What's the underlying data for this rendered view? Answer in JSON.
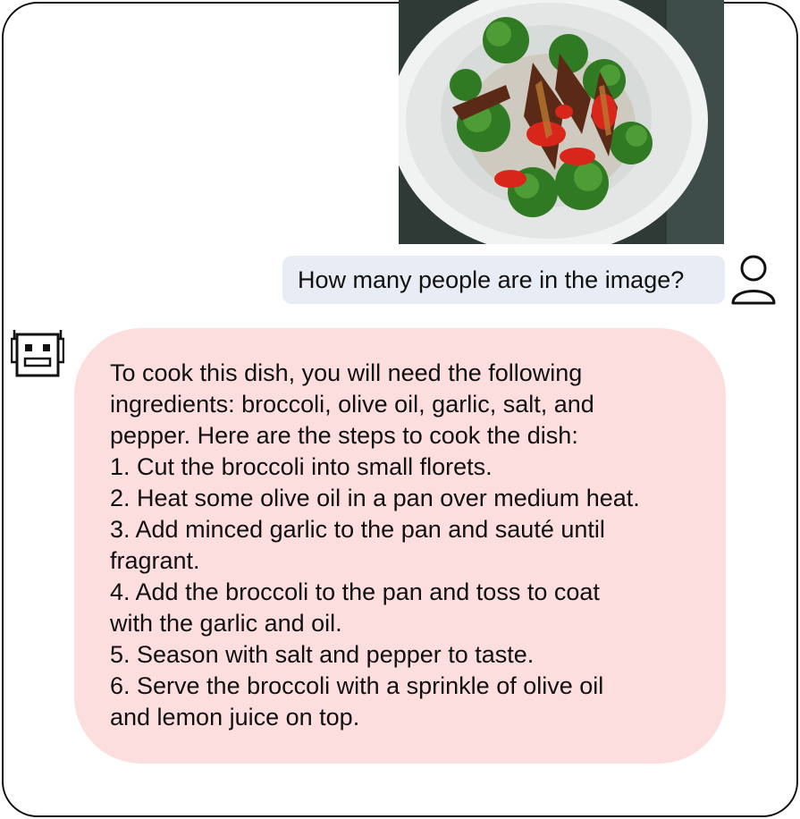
{
  "colors": {
    "user_bubble": "#E8ECF4",
    "bot_bubble": "#FCDEDE",
    "frame_border": "#111111",
    "text": "#111111"
  },
  "image": {
    "description_icon": "food-photo-bowl-of-broccoli-and-fish-icon"
  },
  "user_message": {
    "text": "How many people are in the image?",
    "avatar_icon": "user-icon"
  },
  "bot_message": {
    "avatar_icon": "robot-icon",
    "lines": [
      "To cook this dish, you will need the following",
      "ingredients: broccoli, olive oil, garlic, salt, and",
      "pepper. Here are the steps to cook the dish:",
      "1. Cut the broccoli into small florets.",
      "2. Heat some olive oil in a pan over medium heat.",
      "3. Add minced garlic to the pan and sauté until",
      "fragrant.",
      "4. Add the broccoli to the pan and toss to coat",
      "with the garlic and oil.",
      "5. Season with salt and pepper to taste.",
      "6. Serve the broccoli with a sprinkle of olive oil",
      "and lemon juice on top."
    ]
  }
}
